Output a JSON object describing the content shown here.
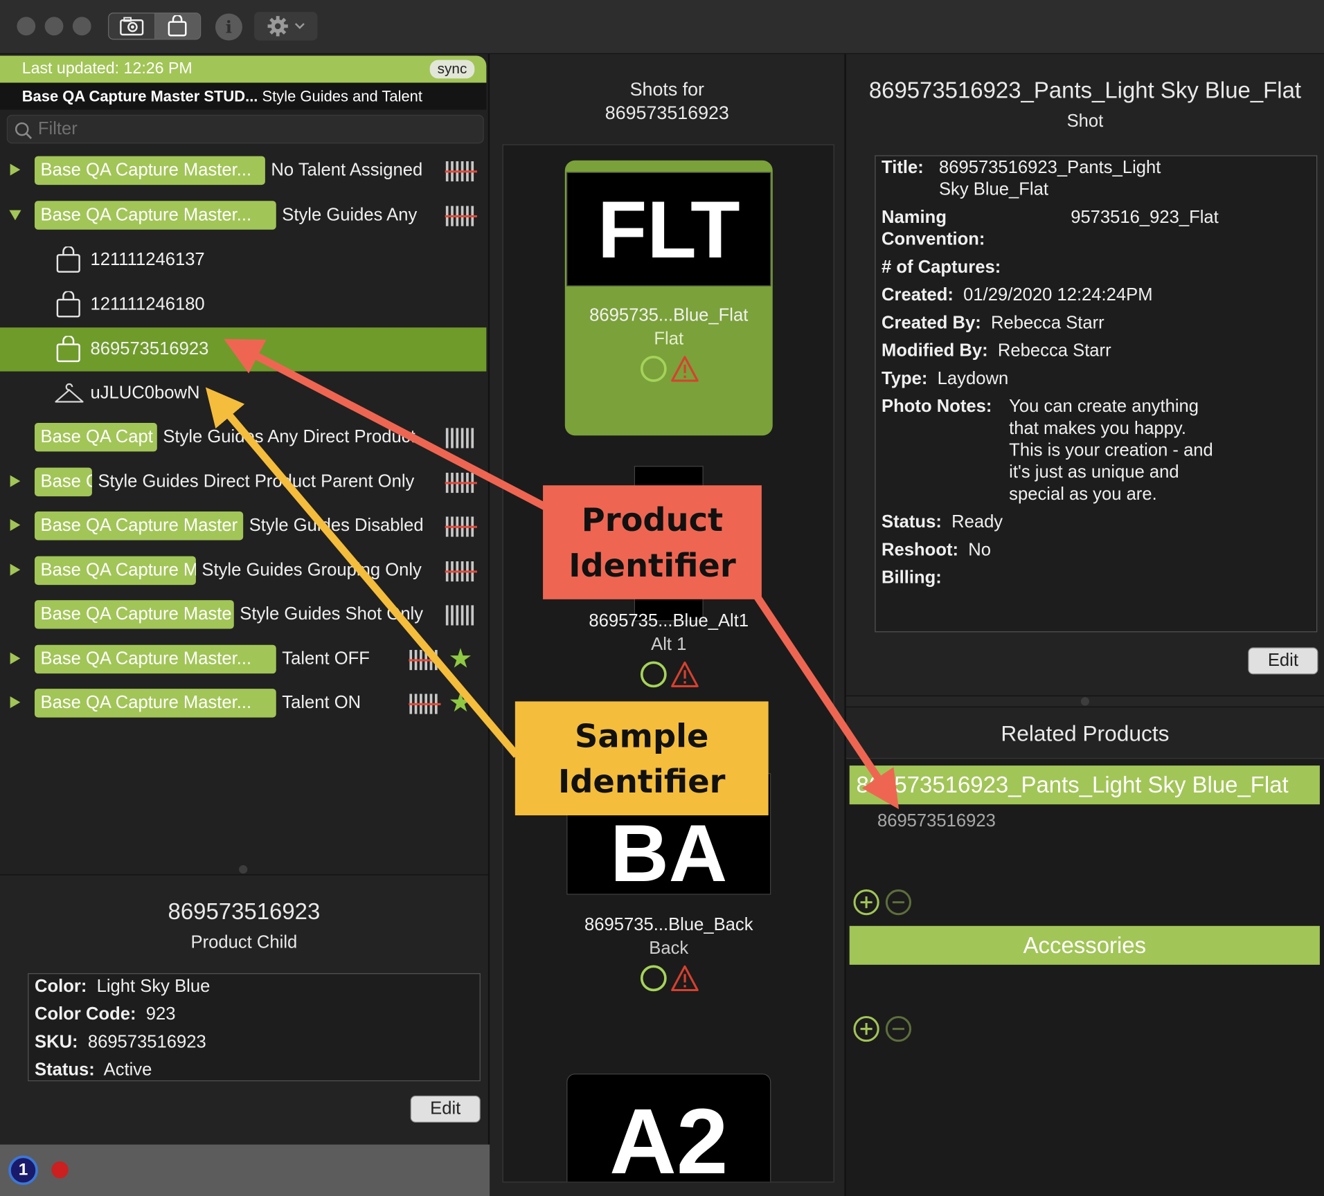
{
  "sidebar": {
    "banner": "Last updated: 12:26 PM",
    "sync": "sync",
    "project_bold": "Base QA Capture Master STUD...",
    "project_rest": "Style Guides and Talent",
    "filter_placeholder": "Filter",
    "rows": [
      {
        "pill": "Base QA Capture Master...",
        "text": "No Talent Assigned"
      },
      {
        "pill": "Base QA Capture Master...",
        "text": "Style Guides Any"
      },
      {
        "pill": "Base QA Capt",
        "text": "Style Guides Any Direct Product"
      },
      {
        "pill": "Base Q",
        "text": "Style Guides Direct Product Parent Only"
      },
      {
        "pill": "Base QA Capture Master",
        "text": "Style Guides Disabled"
      },
      {
        "pill": "Base QA Capture M",
        "text": "Style Guides Grouping Only"
      },
      {
        "pill": "Base QA Capture Maste",
        "text": "Style Guides Shot Only"
      },
      {
        "pill": "Base QA Capture Master...",
        "text": "Talent OFF"
      },
      {
        "pill": "Base QA Capture Master...",
        "text": "Talent ON"
      }
    ],
    "children": [
      "121111246137",
      "121111246180",
      "869573516923",
      "uJLUC0bowN"
    ]
  },
  "product": {
    "title": "869573516923",
    "subtitle": "Product Child",
    "color_label": "Color:",
    "color": "Light Sky Blue",
    "color_code_label": "Color Code:",
    "color_code": "923",
    "sku_label": "SKU:",
    "sku": "869573516923",
    "status_label": "Status:",
    "status": "Active",
    "edit": "Edit"
  },
  "shots": {
    "header": "Shots for\n869573516923",
    "items": [
      {
        "code": "FLT",
        "name": "8695735...Blue_Flat",
        "type": "Flat"
      },
      {
        "code": "",
        "name": "8695735...Blue_Alt1",
        "type": "Alt 1"
      },
      {
        "code": "BA",
        "name": "8695735...Blue_Back",
        "type": "Back"
      },
      {
        "code": "A2",
        "name": "",
        "type": ""
      }
    ]
  },
  "shot_detail": {
    "title": "869573516923_Pants_Light Sky Blue_Flat",
    "subtitle": "Shot",
    "title_label": "Title:",
    "title_value_1": "869573516923_Pants_Light",
    "title_value_2": "Sky Blue_Flat",
    "naming_label_1": "Naming",
    "naming_label_2": "Convention:",
    "naming_value": "9573516_923_Flat",
    "captures_label": "# of Captures:",
    "created_label": "Created:",
    "created": "01/29/2020 12:24:24PM",
    "created_by_label": "Created By:",
    "created_by": "Rebecca Starr",
    "modified_by_label": "Modified By:",
    "modified_by": "Rebecca Starr",
    "type_label": "Type:",
    "type": "Laydown",
    "notes_label": "Photo Notes:",
    "notes": [
      "You can create anything",
      "that makes you happy.",
      "This is your creation - and",
      "it's just as unique and",
      "special as you are."
    ],
    "status_label": "Status:",
    "status": "Ready",
    "reshoot_label": "Reshoot:",
    "reshoot": "No",
    "billing_label": "Billing:",
    "edit": "Edit"
  },
  "related": {
    "header": "Related Products",
    "product_bar": "869573516923_Pants_Light Sky Blue_Flat",
    "product_sub": "869573516923",
    "accessories": "Accessories"
  },
  "annotations": {
    "product_identifier": [
      "Product",
      "Identifier"
    ],
    "sample_identifier": [
      "Sample",
      "Identifier"
    ]
  },
  "colors": {
    "accent": "#a2c557",
    "selected": "#6f9b2b",
    "callout_red": "#ee6652",
    "callout_yellow": "#f5bd3c"
  }
}
